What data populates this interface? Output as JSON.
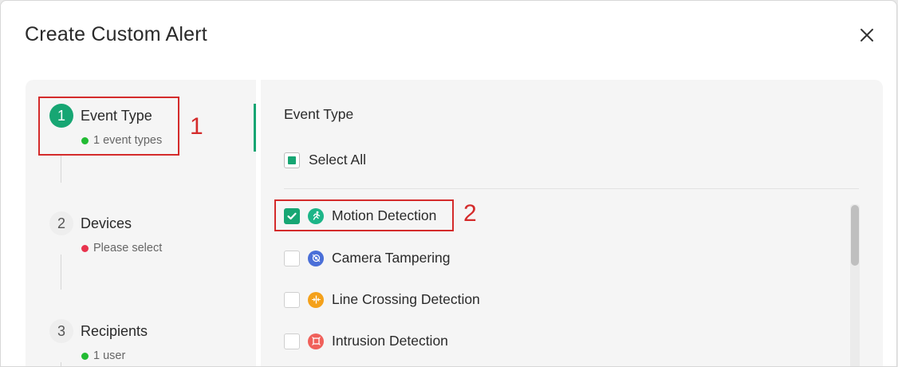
{
  "dialog": {
    "title": "Create Custom Alert",
    "close_icon": "close-icon"
  },
  "steps": [
    {
      "number": "1",
      "label": "Event Type",
      "status": "1 event types",
      "status_color": "#22bb33",
      "active": true,
      "annotation": "1"
    },
    {
      "number": "2",
      "label": "Devices",
      "status": "Please select",
      "status_color": "#e8334d",
      "active": false
    },
    {
      "number": "3",
      "label": "Recipients",
      "status": "1 user",
      "status_color": "#22bb33",
      "active": false
    }
  ],
  "event_panel": {
    "title": "Event Type",
    "select_all": {
      "label": "Select All",
      "state": "partial"
    },
    "items": [
      {
        "label": "Motion Detection",
        "checked": true,
        "icon": "running-person-icon",
        "icon_color": "#1db588",
        "annotation": "2"
      },
      {
        "label": "Camera Tampering",
        "checked": false,
        "icon": "camera-tamper-icon",
        "icon_color": "#4a6fd8"
      },
      {
        "label": "Line Crossing Detection",
        "checked": false,
        "icon": "line-crossing-icon",
        "icon_color": "#f4a11b"
      },
      {
        "label": "Intrusion Detection",
        "checked": false,
        "icon": "intrusion-icon",
        "icon_color": "#f0605a"
      }
    ]
  },
  "colors": {
    "accent": "#17a673",
    "annotation": "#d42b2b"
  }
}
